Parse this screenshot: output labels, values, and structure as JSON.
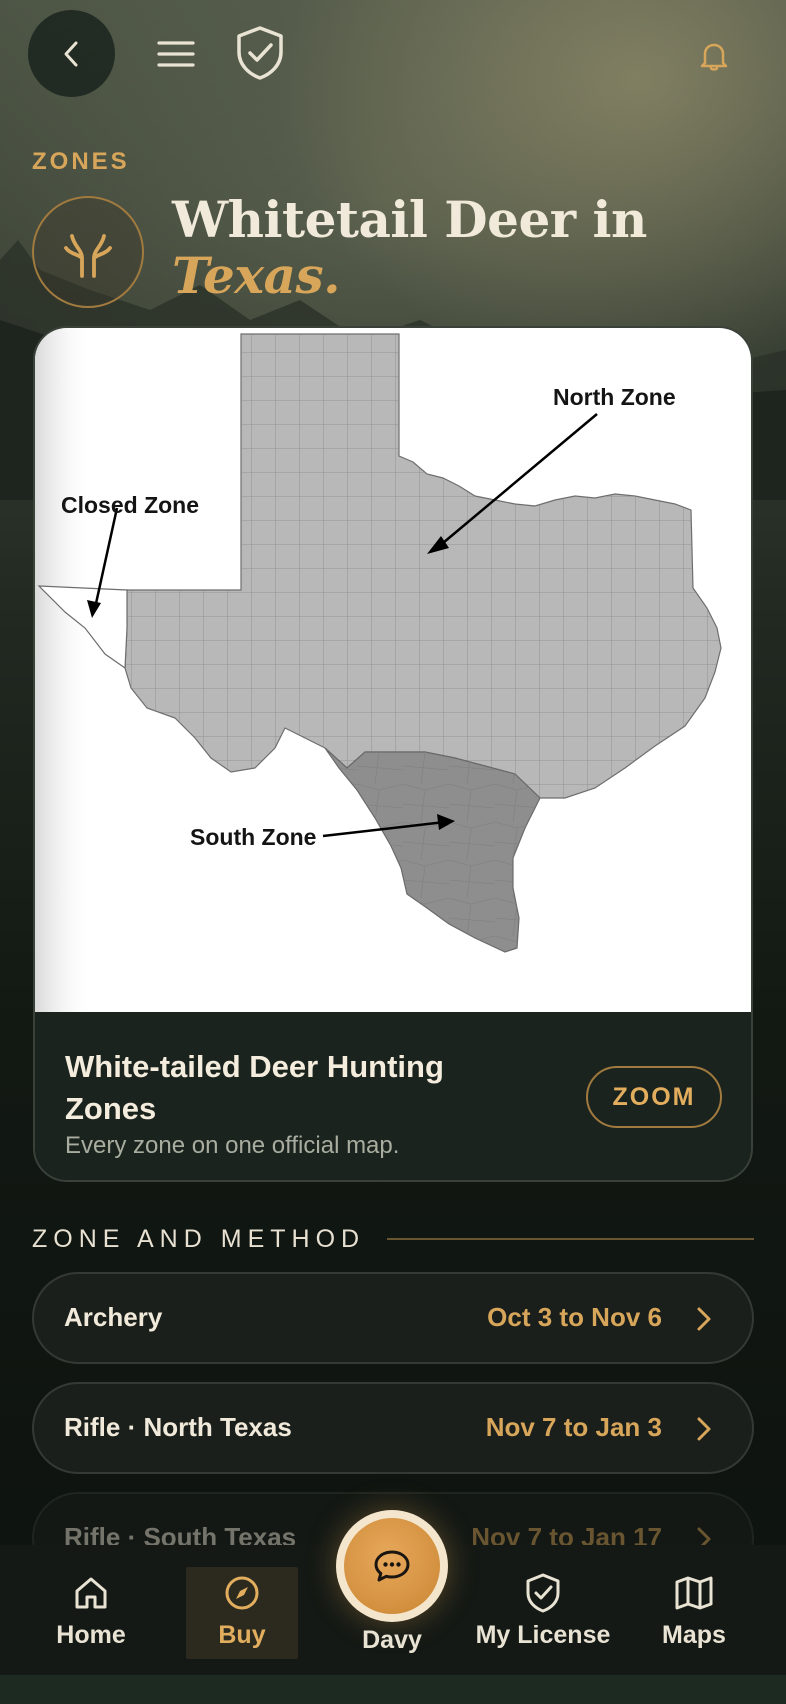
{
  "header": {
    "eyebrow": "ZONES",
    "title_line1": "Whitetail Deer in",
    "title_line2": "Texas."
  },
  "icons": {
    "back": "chevron-left-icon",
    "menu": "hamburger-menu-icon",
    "shield": "shield-check-icon",
    "bell": "bell-icon",
    "species": "antler-icon"
  },
  "map_card": {
    "labels": {
      "north": "North Zone",
      "closed": "Closed Zone",
      "south": "South Zone"
    },
    "title": "White-tailed Deer Hunting Zones",
    "subtitle": "Every zone on one official map.",
    "zoom_label": "ZOOM"
  },
  "section": {
    "title": "ZONE AND METHOD"
  },
  "seasons": [
    {
      "name": "Archery",
      "dates": "Oct 3 to Nov 6"
    },
    {
      "name": "Rifle · North Texas",
      "dates": "Nov 7 to Jan 3"
    },
    {
      "name": "Rifle · South Texas",
      "dates": "Nov 7 to Jan 17"
    }
  ],
  "nav": {
    "home": "Home",
    "buy": "Buy",
    "davy": "Davy",
    "license": "My License",
    "maps": "Maps",
    "active": "buy"
  },
  "colors": {
    "accent": "#d8a65a",
    "background": "#0e1310",
    "card": "#1b231e"
  }
}
